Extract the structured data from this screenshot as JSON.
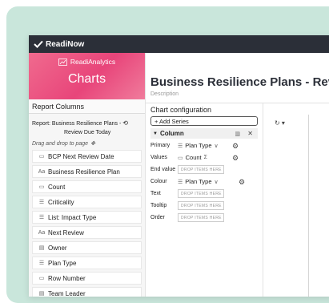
{
  "app": {
    "brand": "ReadiNow"
  },
  "left_panel": {
    "banner_subtitle": "ReadiAnalytics",
    "banner_title": "Charts",
    "section_title": "Report Columns",
    "report_label": "Report: Business Resilience Plans -",
    "report_label_line2": "Review Due Today",
    "drag_hint": "Drag and drop to page",
    "fields": [
      {
        "icon": "calendar-icon",
        "glyph": "▭",
        "label": "BCP Next Review Date"
      },
      {
        "icon": "text-icon",
        "glyph": "Aa",
        "label": "Business Resilience Plan"
      },
      {
        "icon": "number-icon",
        "glyph": "▭",
        "label": "Count"
      },
      {
        "icon": "list-icon",
        "glyph": "☰",
        "label": "Criticality"
      },
      {
        "icon": "list-icon",
        "glyph": "☰",
        "label": "List: Impact Type"
      },
      {
        "icon": "text-icon",
        "glyph": "Aa",
        "label": "Next Review"
      },
      {
        "icon": "lookup-icon",
        "glyph": "▤",
        "label": "Owner"
      },
      {
        "icon": "list-icon",
        "glyph": "☰",
        "label": "Plan Type"
      },
      {
        "icon": "number-icon",
        "glyph": "▭",
        "label": "Row Number"
      },
      {
        "icon": "lookup-icon",
        "glyph": "▤",
        "label": "Team Leader"
      }
    ]
  },
  "main": {
    "page_title": "Business Resilience Plans - Review D",
    "description_placeholder": "Description",
    "config_title": "Chart configuration",
    "add_series_label": "+ Add Series",
    "series_header": "Column",
    "rows": {
      "primary": {
        "label": "Primary",
        "value": "Plan Type"
      },
      "values": {
        "label": "Values",
        "value": "Count"
      },
      "end_value": {
        "label": "End value",
        "drop": "DROP ITEMS HERE"
      },
      "colour": {
        "label": "Colour",
        "value": "Plan Type"
      },
      "text": {
        "label": "Text",
        "drop": "DROP ITEMS HERE"
      },
      "tooltip": {
        "label": "Tooltip",
        "drop": "DROP ITEMS HERE"
      },
      "order": {
        "label": "Order",
        "drop": "DROP ITEMS HERE"
      }
    }
  },
  "colors": {
    "topbar": "#2b2f38",
    "banner": "#e8457a",
    "background": "#c9e6db"
  }
}
